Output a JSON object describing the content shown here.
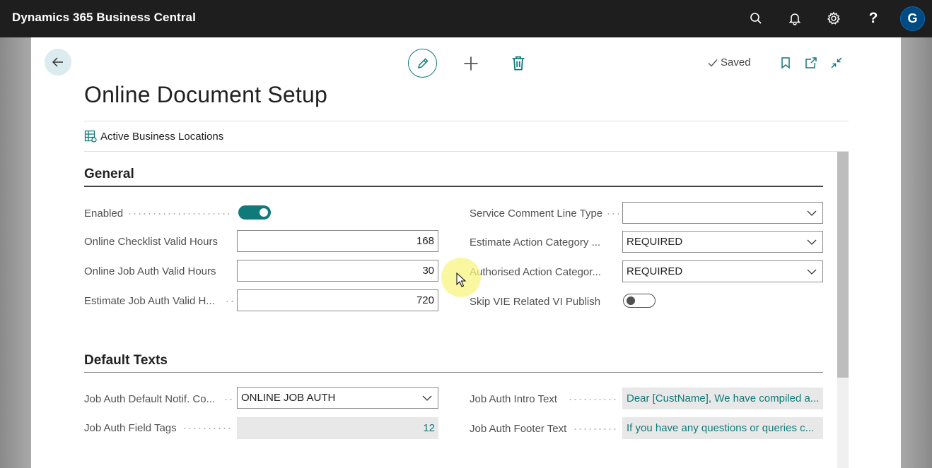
{
  "app": {
    "name": "Dynamics 365 Business Central",
    "user_initial": "G"
  },
  "topbar_icons": [
    "search-icon",
    "bell-icon",
    "gear-icon",
    "help-icon"
  ],
  "help_glyph": "?",
  "status": {
    "saved_label": "Saved"
  },
  "page": {
    "title": "Online Document Setup"
  },
  "actions": {
    "active_business_locations": "Active Business Locations"
  },
  "sections": {
    "general": {
      "title": "General",
      "fields": {
        "enabled": {
          "label": "Enabled",
          "value": true
        },
        "online_checklist_valid_hours": {
          "label": "Online Checklist Valid Hours",
          "value": "168"
        },
        "online_job_auth_valid_hours": {
          "label": "Online Job Auth Valid Hours",
          "value": "30"
        },
        "estimate_job_auth_valid_hours": {
          "label": "Estimate Job Auth Valid H...",
          "value": "720"
        },
        "service_comment_line_type": {
          "label": "Service Comment Line Type",
          "value": ""
        },
        "estimate_action_category": {
          "label": "Estimate Action Category ...",
          "value": "REQUIRED"
        },
        "authorised_action_category": {
          "label": "Authorised Action Categor...",
          "value": "REQUIRED"
        },
        "skip_vie_related_vi_publish": {
          "label": "Skip VIE Related VI Publish",
          "value": false
        }
      }
    },
    "default_texts": {
      "title": "Default Texts",
      "fields": {
        "job_auth_default_notif_code": {
          "label": "Job Auth Default Notif. Co...",
          "value": "ONLINE JOB AUTH"
        },
        "job_auth_field_tags": {
          "label": "Job Auth Field Tags",
          "value": "12"
        },
        "job_auth_intro_text": {
          "label": "Job Auth Intro Text",
          "value": "Dear [CustName], We have compiled a..."
        },
        "job_auth_footer_text": {
          "label": "Job Auth Footer Text",
          "value": "If you have any questions or queries c..."
        }
      }
    }
  },
  "colors": {
    "accent": "#0f7a79",
    "topbar": "#1e1e1e",
    "avatar": "#004a83"
  }
}
